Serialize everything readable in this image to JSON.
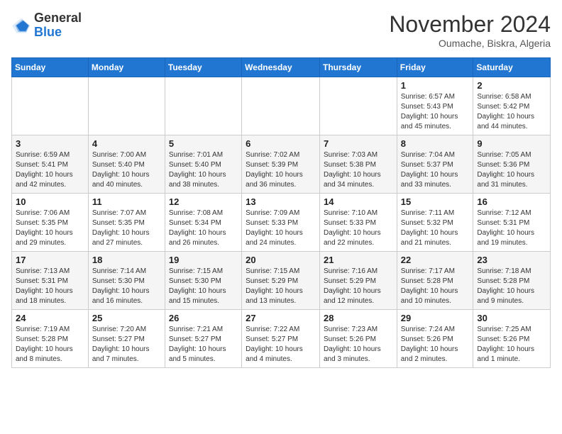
{
  "logo": {
    "general": "General",
    "blue": "Blue"
  },
  "title": {
    "month": "November 2024",
    "location": "Oumache, Biskra, Algeria"
  },
  "headers": [
    "Sunday",
    "Monday",
    "Tuesday",
    "Wednesday",
    "Thursday",
    "Friday",
    "Saturday"
  ],
  "weeks": [
    [
      {
        "day": "",
        "info": ""
      },
      {
        "day": "",
        "info": ""
      },
      {
        "day": "",
        "info": ""
      },
      {
        "day": "",
        "info": ""
      },
      {
        "day": "",
        "info": ""
      },
      {
        "day": "1",
        "info": "Sunrise: 6:57 AM\nSunset: 5:43 PM\nDaylight: 10 hours and 45 minutes."
      },
      {
        "day": "2",
        "info": "Sunrise: 6:58 AM\nSunset: 5:42 PM\nDaylight: 10 hours and 44 minutes."
      }
    ],
    [
      {
        "day": "3",
        "info": "Sunrise: 6:59 AM\nSunset: 5:41 PM\nDaylight: 10 hours and 42 minutes."
      },
      {
        "day": "4",
        "info": "Sunrise: 7:00 AM\nSunset: 5:40 PM\nDaylight: 10 hours and 40 minutes."
      },
      {
        "day": "5",
        "info": "Sunrise: 7:01 AM\nSunset: 5:40 PM\nDaylight: 10 hours and 38 minutes."
      },
      {
        "day": "6",
        "info": "Sunrise: 7:02 AM\nSunset: 5:39 PM\nDaylight: 10 hours and 36 minutes."
      },
      {
        "day": "7",
        "info": "Sunrise: 7:03 AM\nSunset: 5:38 PM\nDaylight: 10 hours and 34 minutes."
      },
      {
        "day": "8",
        "info": "Sunrise: 7:04 AM\nSunset: 5:37 PM\nDaylight: 10 hours and 33 minutes."
      },
      {
        "day": "9",
        "info": "Sunrise: 7:05 AM\nSunset: 5:36 PM\nDaylight: 10 hours and 31 minutes."
      }
    ],
    [
      {
        "day": "10",
        "info": "Sunrise: 7:06 AM\nSunset: 5:35 PM\nDaylight: 10 hours and 29 minutes."
      },
      {
        "day": "11",
        "info": "Sunrise: 7:07 AM\nSunset: 5:35 PM\nDaylight: 10 hours and 27 minutes."
      },
      {
        "day": "12",
        "info": "Sunrise: 7:08 AM\nSunset: 5:34 PM\nDaylight: 10 hours and 26 minutes."
      },
      {
        "day": "13",
        "info": "Sunrise: 7:09 AM\nSunset: 5:33 PM\nDaylight: 10 hours and 24 minutes."
      },
      {
        "day": "14",
        "info": "Sunrise: 7:10 AM\nSunset: 5:33 PM\nDaylight: 10 hours and 22 minutes."
      },
      {
        "day": "15",
        "info": "Sunrise: 7:11 AM\nSunset: 5:32 PM\nDaylight: 10 hours and 21 minutes."
      },
      {
        "day": "16",
        "info": "Sunrise: 7:12 AM\nSunset: 5:31 PM\nDaylight: 10 hours and 19 minutes."
      }
    ],
    [
      {
        "day": "17",
        "info": "Sunrise: 7:13 AM\nSunset: 5:31 PM\nDaylight: 10 hours and 18 minutes."
      },
      {
        "day": "18",
        "info": "Sunrise: 7:14 AM\nSunset: 5:30 PM\nDaylight: 10 hours and 16 minutes."
      },
      {
        "day": "19",
        "info": "Sunrise: 7:15 AM\nSunset: 5:30 PM\nDaylight: 10 hours and 15 minutes."
      },
      {
        "day": "20",
        "info": "Sunrise: 7:15 AM\nSunset: 5:29 PM\nDaylight: 10 hours and 13 minutes."
      },
      {
        "day": "21",
        "info": "Sunrise: 7:16 AM\nSunset: 5:29 PM\nDaylight: 10 hours and 12 minutes."
      },
      {
        "day": "22",
        "info": "Sunrise: 7:17 AM\nSunset: 5:28 PM\nDaylight: 10 hours and 10 minutes."
      },
      {
        "day": "23",
        "info": "Sunrise: 7:18 AM\nSunset: 5:28 PM\nDaylight: 10 hours and 9 minutes."
      }
    ],
    [
      {
        "day": "24",
        "info": "Sunrise: 7:19 AM\nSunset: 5:28 PM\nDaylight: 10 hours and 8 minutes."
      },
      {
        "day": "25",
        "info": "Sunrise: 7:20 AM\nSunset: 5:27 PM\nDaylight: 10 hours and 7 minutes."
      },
      {
        "day": "26",
        "info": "Sunrise: 7:21 AM\nSunset: 5:27 PM\nDaylight: 10 hours and 5 minutes."
      },
      {
        "day": "27",
        "info": "Sunrise: 7:22 AM\nSunset: 5:27 PM\nDaylight: 10 hours and 4 minutes."
      },
      {
        "day": "28",
        "info": "Sunrise: 7:23 AM\nSunset: 5:26 PM\nDaylight: 10 hours and 3 minutes."
      },
      {
        "day": "29",
        "info": "Sunrise: 7:24 AM\nSunset: 5:26 PM\nDaylight: 10 hours and 2 minutes."
      },
      {
        "day": "30",
        "info": "Sunrise: 7:25 AM\nSunset: 5:26 PM\nDaylight: 10 hours and 1 minute."
      }
    ]
  ]
}
